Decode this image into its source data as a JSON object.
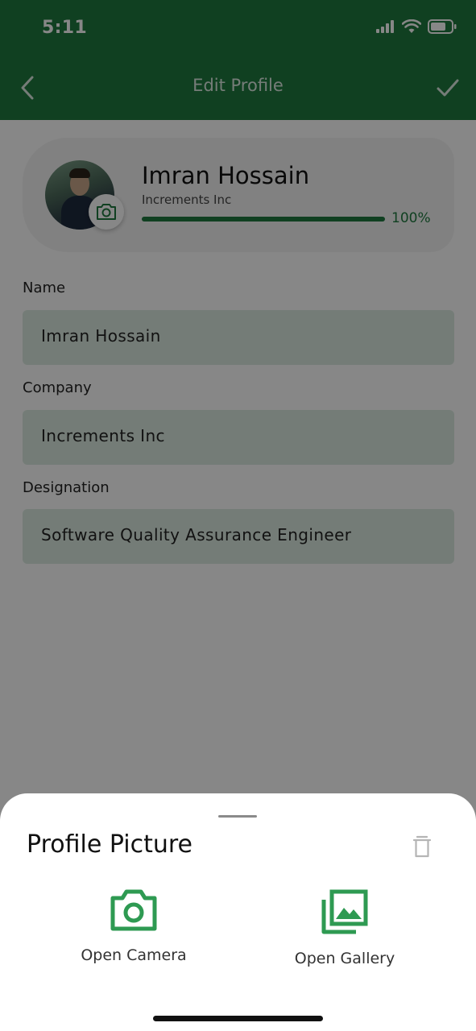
{
  "status_bar": {
    "time": "5:11"
  },
  "nav": {
    "title": "Edit Profile"
  },
  "profile": {
    "name": "Imran Hossain",
    "company": "Increments Inc",
    "completion_percent": 100,
    "completion_label": "100%"
  },
  "fields": [
    {
      "label": "Name",
      "value": "Imran Hossain"
    },
    {
      "label": "Company",
      "value": "Increments Inc"
    },
    {
      "label": "Designation",
      "value": "Software Quality Assurance Engineer"
    }
  ],
  "sheet": {
    "title": "Profile Picture",
    "options": [
      {
        "label": "Open Camera",
        "icon": "camera-icon"
      },
      {
        "label": "Open Gallery",
        "icon": "gallery-icon"
      }
    ]
  },
  "colors": {
    "primary": "#1f7a3f",
    "field_bg": "#dcebe0",
    "icon_green": "#2e9a52"
  }
}
